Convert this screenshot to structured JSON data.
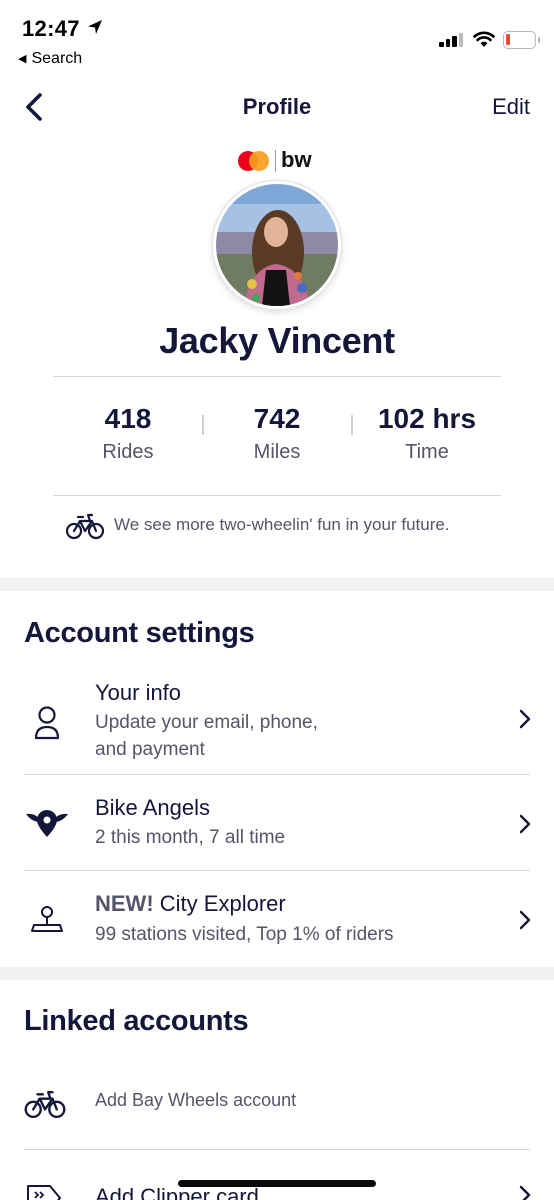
{
  "status_bar": {
    "time": "12:47",
    "back_label": "Search",
    "battery_color": "#e24d37"
  },
  "nav": {
    "title": "Profile",
    "edit_label": "Edit"
  },
  "brand": {
    "text": "bw",
    "icon": "mastercard-logo"
  },
  "profile": {
    "name": "Jacky Vincent",
    "stats": [
      {
        "value": "418",
        "label": "Rides"
      },
      {
        "value": "742",
        "label": "Miles"
      },
      {
        "value": "102 hrs",
        "label": "Time"
      }
    ],
    "message": "We see more two-wheelin' fun in your future."
  },
  "account_settings": {
    "title": "Account settings",
    "items": [
      {
        "title": "Your info",
        "subtitle_line1": "Update your email, phone,",
        "subtitle_line2": "and payment",
        "icon": "person-icon"
      },
      {
        "title": "Bike Angels",
        "subtitle": "2 this month, 7 all time",
        "icon": "bike-angels-icon"
      },
      {
        "badge": "NEW!",
        "title": "City Explorer",
        "subtitle": "99 stations visited, Top 1% of riders",
        "icon": "map-pin-icon"
      }
    ]
  },
  "linked_accounts": {
    "title": "Linked accounts",
    "items": [
      {
        "title": "Add Bay Wheels account",
        "icon": "bike-icon"
      },
      {
        "title": "Add Clipper card",
        "icon": "card-tag-icon"
      }
    ]
  },
  "colors": {
    "navy": "#16163a",
    "gray_text": "#55556a",
    "band": "#f1f1f3",
    "mastercard_red": "#eb001b",
    "mastercard_orange": "#f79e1b"
  }
}
